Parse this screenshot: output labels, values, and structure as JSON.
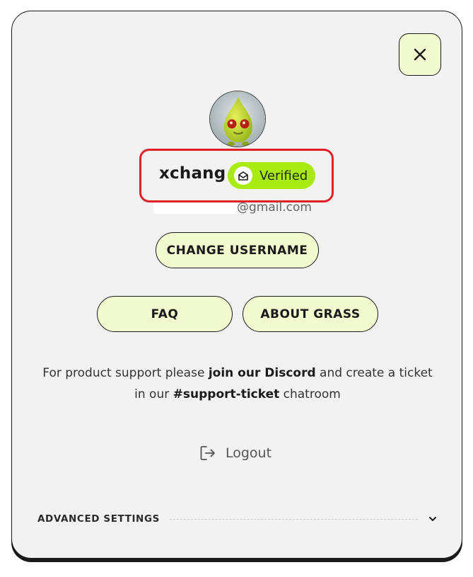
{
  "profile": {
    "username": "xchang",
    "verified_label": "Verified",
    "email_suffix": "@gmail.com"
  },
  "actions": {
    "change_username": "CHANGE USERNAME",
    "faq": "FAQ",
    "about": "ABOUT GRASS",
    "logout": "Logout"
  },
  "support": {
    "part1": "For product support please ",
    "discord_link": "join our Discord",
    "part2": " and create a ticket in our ",
    "channel": "#support-ticket",
    "part3": " chatroom"
  },
  "advanced": {
    "label": "ADVANCED SETTINGS"
  },
  "colors": {
    "accent": "#a9ea12",
    "button_bg": "#f1fbcf",
    "panel_bg": "#f2f2f2",
    "highlight": "#e0202a"
  },
  "icons": {
    "close": "close-icon",
    "verified": "envelope-icon",
    "logout": "logout-icon",
    "expand": "chevron-down-icon"
  }
}
